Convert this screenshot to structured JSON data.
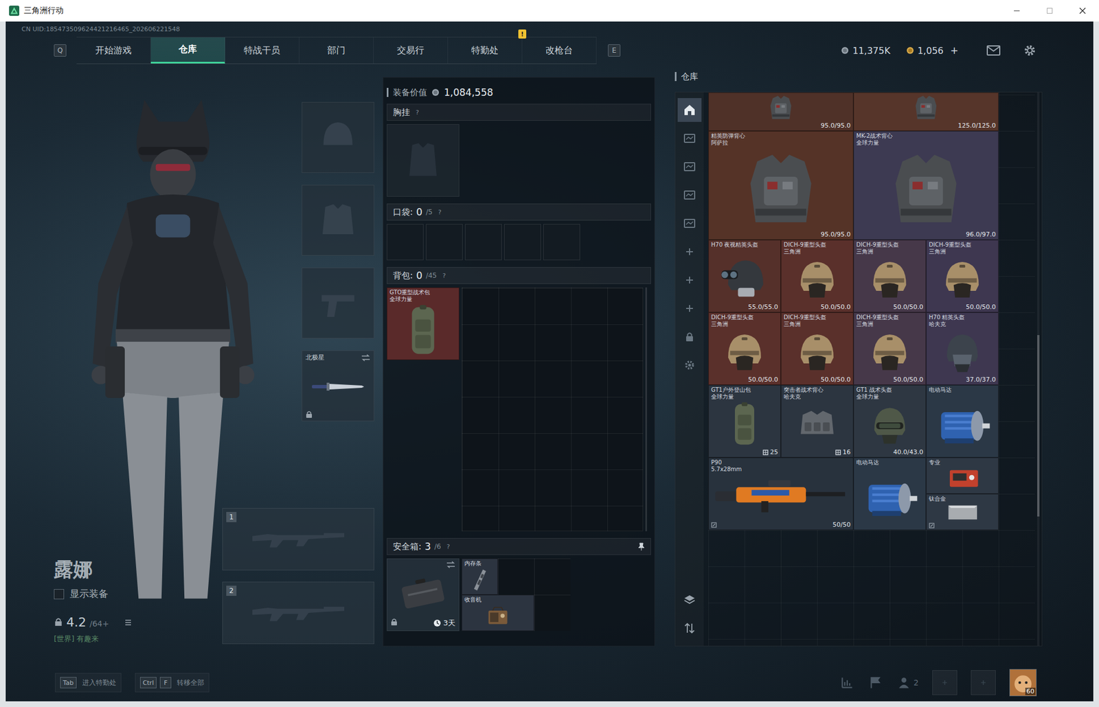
{
  "window": {
    "title": "三角洲行动"
  },
  "uid": "CN UID:185473509624421216465_202606221548",
  "nav": {
    "prev_key": "Q",
    "next_key": "E",
    "tabs": [
      {
        "label": "开始游戏",
        "selected": false
      },
      {
        "label": "仓库",
        "selected": true
      },
      {
        "label": "特战干员",
        "selected": false
      },
      {
        "label": "部门",
        "selected": false
      },
      {
        "label": "交易行",
        "selected": false
      },
      {
        "label": "特勤处",
        "selected": false,
        "badge": "!"
      },
      {
        "label": "改枪台",
        "selected": false
      }
    ]
  },
  "currency": {
    "silver": "11,375K",
    "gold": "1,056",
    "add": "+"
  },
  "character": {
    "name": "露娜",
    "show_gear": {
      "label": "显示装备",
      "checked": false
    },
    "rating": "4.2",
    "rating_max": "/64+",
    "chat": "[世界] 有趣来"
  },
  "equipment": {
    "slots": [
      {
        "kind": "helmet",
        "empty": true
      },
      {
        "kind": "armor",
        "empty": true
      },
      {
        "kind": "pistol",
        "empty": true
      },
      {
        "kind": "melee",
        "empty": false,
        "label": "北极星",
        "locked": true
      }
    ],
    "weapons": [
      {
        "number": "1",
        "empty": true
      },
      {
        "number": "2",
        "empty": true
      }
    ]
  },
  "loadout": {
    "value_label": "装备价值",
    "value": "1,084,558",
    "chest": {
      "label": "胸挂",
      "help": "?"
    },
    "pockets": {
      "label": "口袋:",
      "count": "0",
      "capacity": "/5",
      "help": "?",
      "slots": 5
    },
    "backpack": {
      "label": "背包:",
      "count": "0",
      "capacity": "/45",
      "help": "?",
      "item": {
        "name": "GTO重型战术包",
        "brand": "全球力量",
        "kind": "backpack",
        "color": "#5a2a2a"
      }
    },
    "safe": {
      "label": "安全箱:",
      "count": "3",
      "capacity": "/6",
      "help": "?",
      "timer": "3天",
      "locked": true,
      "items": [
        {
          "name": "内存条",
          "kind": "ram",
          "color": "#2c3440"
        },
        {
          "name": "收音机",
          "kind": "radio",
          "color": "#2c3440"
        }
      ]
    }
  },
  "warehouse": {
    "title": "仓库",
    "tabs": [
      {
        "kind": "home",
        "selected": true
      },
      {
        "kind": "page",
        "selected": false
      },
      {
        "kind": "page",
        "selected": false
      },
      {
        "kind": "page",
        "selected": false
      },
      {
        "kind": "page",
        "selected": false
      },
      {
        "kind": "add",
        "selected": false
      },
      {
        "kind": "add",
        "selected": false
      },
      {
        "kind": "add",
        "selected": false
      },
      {
        "kind": "lock",
        "selected": false
      },
      {
        "kind": "settings",
        "selected": false
      }
    ],
    "tools": [
      {
        "kind": "layers"
      },
      {
        "kind": "sort"
      }
    ],
    "items": [
      {
        "name": "",
        "brand": "",
        "kind": "vest",
        "partial": true,
        "durability": "95.0/95.0",
        "color": "#4f3128"
      },
      {
        "name": "",
        "brand": "",
        "kind": "vest",
        "partial": true,
        "durability": "125.0/125.0",
        "color": "#56352a"
      },
      {
        "name": "精英防弹背心",
        "brand": "阿萨拉",
        "kind": "vest",
        "partial": false,
        "durability": "95.0/95.0",
        "color": "#553327"
      },
      {
        "name": "MK-2战术背心",
        "brand": "全球力量",
        "kind": "vest",
        "partial": false,
        "durability": "96.0/97.0",
        "color": "#3d3a52"
      },
      {
        "name": "H70 夜视精英头盔",
        "brand": "",
        "kind": "nvg",
        "partial": false,
        "durability": "55.0/55.0",
        "color": "#55302a"
      },
      {
        "name": "DICH-9重型头盔",
        "brand": "三角洲",
        "kind": "helmet",
        "partial": false,
        "durability": "50.0/50.0",
        "color": "#5a302b"
      },
      {
        "name": "DICH-9重型头盔",
        "brand": "三角洲",
        "kind": "helmet",
        "partial": false,
        "durability": "50.0/50.0",
        "color": "#463849"
      },
      {
        "name": "DICH-9重型头盔",
        "brand": "三角洲",
        "kind": "helmet",
        "partial": false,
        "durability": "50.0/50.0",
        "color": "#3e3750"
      },
      {
        "name": "DICH-9重型头盔",
        "brand": "三角洲",
        "kind": "helmet",
        "partial": false,
        "durability": "50.0/50.0",
        "color": "#5a302b"
      },
      {
        "name": "DICH-9重型头盔",
        "brand": "三角洲",
        "kind": "helmet",
        "partial": false,
        "durability": "50.0/50.0",
        "color": "#5a302b"
      },
      {
        "name": "DICH-9重型头盔",
        "brand": "三角洲",
        "kind": "helmet",
        "partial": false,
        "durability": "50.0/50.0",
        "color": "#463849"
      },
      {
        "name": "H70 精英头盔",
        "brand": "哈夫克",
        "kind": "elite",
        "partial": false,
        "durability": "37.0/37.0",
        "color": "#3e3750"
      },
      {
        "name": "GT1户外登山包",
        "brand": "全球力量",
        "kind": "backpack",
        "partial": false,
        "capacity": "25",
        "color": "#2c3540"
      },
      {
        "name": "突击者战术背心",
        "brand": "哈夫克",
        "kind": "rig",
        "partial": false,
        "capacity": "16",
        "color": "#2c3540"
      },
      {
        "name": "GT1 战术头盔",
        "brand": "全球力量",
        "kind": "tactical",
        "partial": false,
        "durability": "40.0/43.0",
        "color": "#2e3742"
      },
      {
        "name": "电动马达",
        "brand": "",
        "kind": "motor",
        "partial": false,
        "color": "#2b3846"
      },
      {
        "name": "P90",
        "brand": "5.7x28mm",
        "kind": "gun",
        "partial": false,
        "durability": "50/50",
        "modded": true,
        "color": "#28323d"
      },
      {
        "name": "电动马达",
        "brand": "",
        "kind": "motor",
        "partial": false,
        "color": "#2b3846"
      },
      {
        "name": "专业",
        "brand": "",
        "kind": "tool",
        "partial": false,
        "color": "#2e3844"
      },
      {
        "name": "钛合金",
        "brand": "",
        "kind": "plate",
        "partial": false,
        "modded": true,
        "color": "#2e3844"
      }
    ]
  },
  "bottom": {
    "hints": [
      {
        "keys": [
          "Tab"
        ],
        "label": "进入特勤处"
      },
      {
        "keys": [
          "Ctrl",
          "F"
        ],
        "label": "转移全部"
      }
    ],
    "friends": "2",
    "level": "60"
  }
}
